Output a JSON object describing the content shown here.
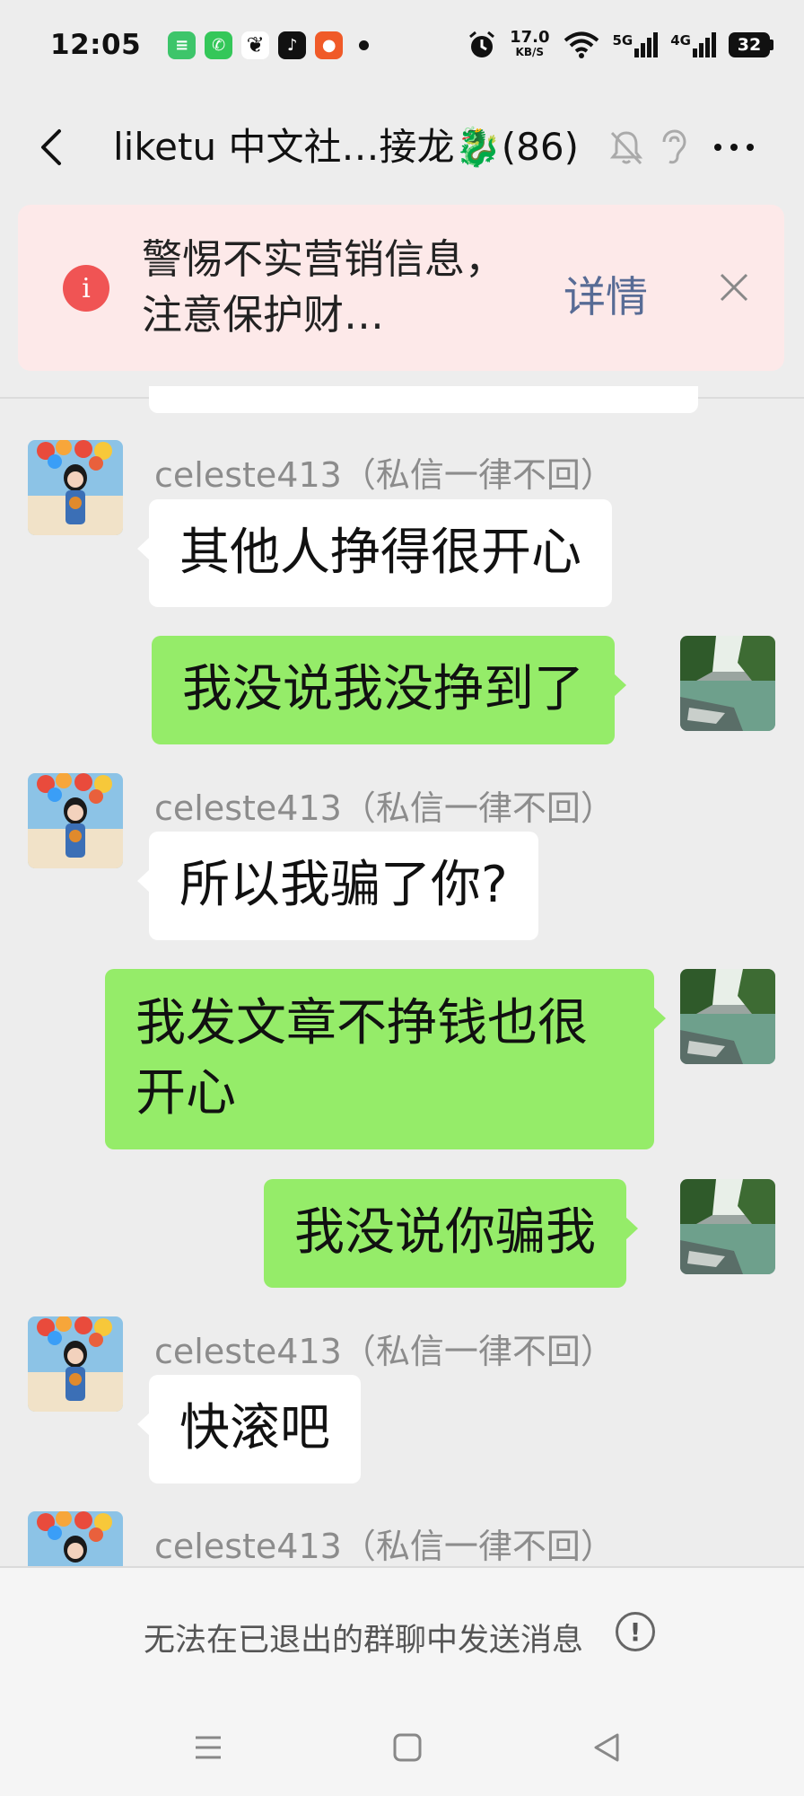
{
  "status_bar": {
    "time": "12:05",
    "speed_value": "17.0",
    "speed_unit": "KB/S",
    "net_5g": "5G",
    "net_4g": "4G",
    "battery": "32",
    "notification_icons": [
      "messages-icon",
      "phone-icon",
      "wechat-icon",
      "tiktok-icon",
      "app-icon"
    ]
  },
  "nav": {
    "title": "liketu 中文社…接龙🐉(86)",
    "icons": [
      "back-icon",
      "mute-icon",
      "earpiece-icon",
      "more-icon"
    ]
  },
  "banner": {
    "text": "警惕不实营销信息，注意保护财…",
    "detail_label": "详情",
    "accent_color": "#f05454"
  },
  "messages": [
    {
      "side": "in",
      "sender": "celeste413（私信一律不回）",
      "text": "其他人挣得很开心"
    },
    {
      "side": "out",
      "text": "我没说我没挣到了"
    },
    {
      "side": "in",
      "sender": "celeste413（私信一律不回）",
      "text": "所以我骗了你?"
    },
    {
      "side": "out",
      "text": "我发文章不挣钱也很开心"
    },
    {
      "side": "out",
      "text": "我没说你骗我"
    },
    {
      "side": "in",
      "sender": "celeste413（私信一律不回）",
      "text": "快滚吧"
    },
    {
      "side": "in",
      "sender": "celeste413（私信一律不回）",
      "text": ""
    }
  ],
  "footer": {
    "text": "无法在已退出的群聊中发送消息",
    "info_glyph": "!"
  },
  "colors": {
    "background": "#ededed",
    "outgoing_bubble": "#95ec69",
    "incoming_bubble": "#ffffff",
    "link": "#576b95"
  }
}
